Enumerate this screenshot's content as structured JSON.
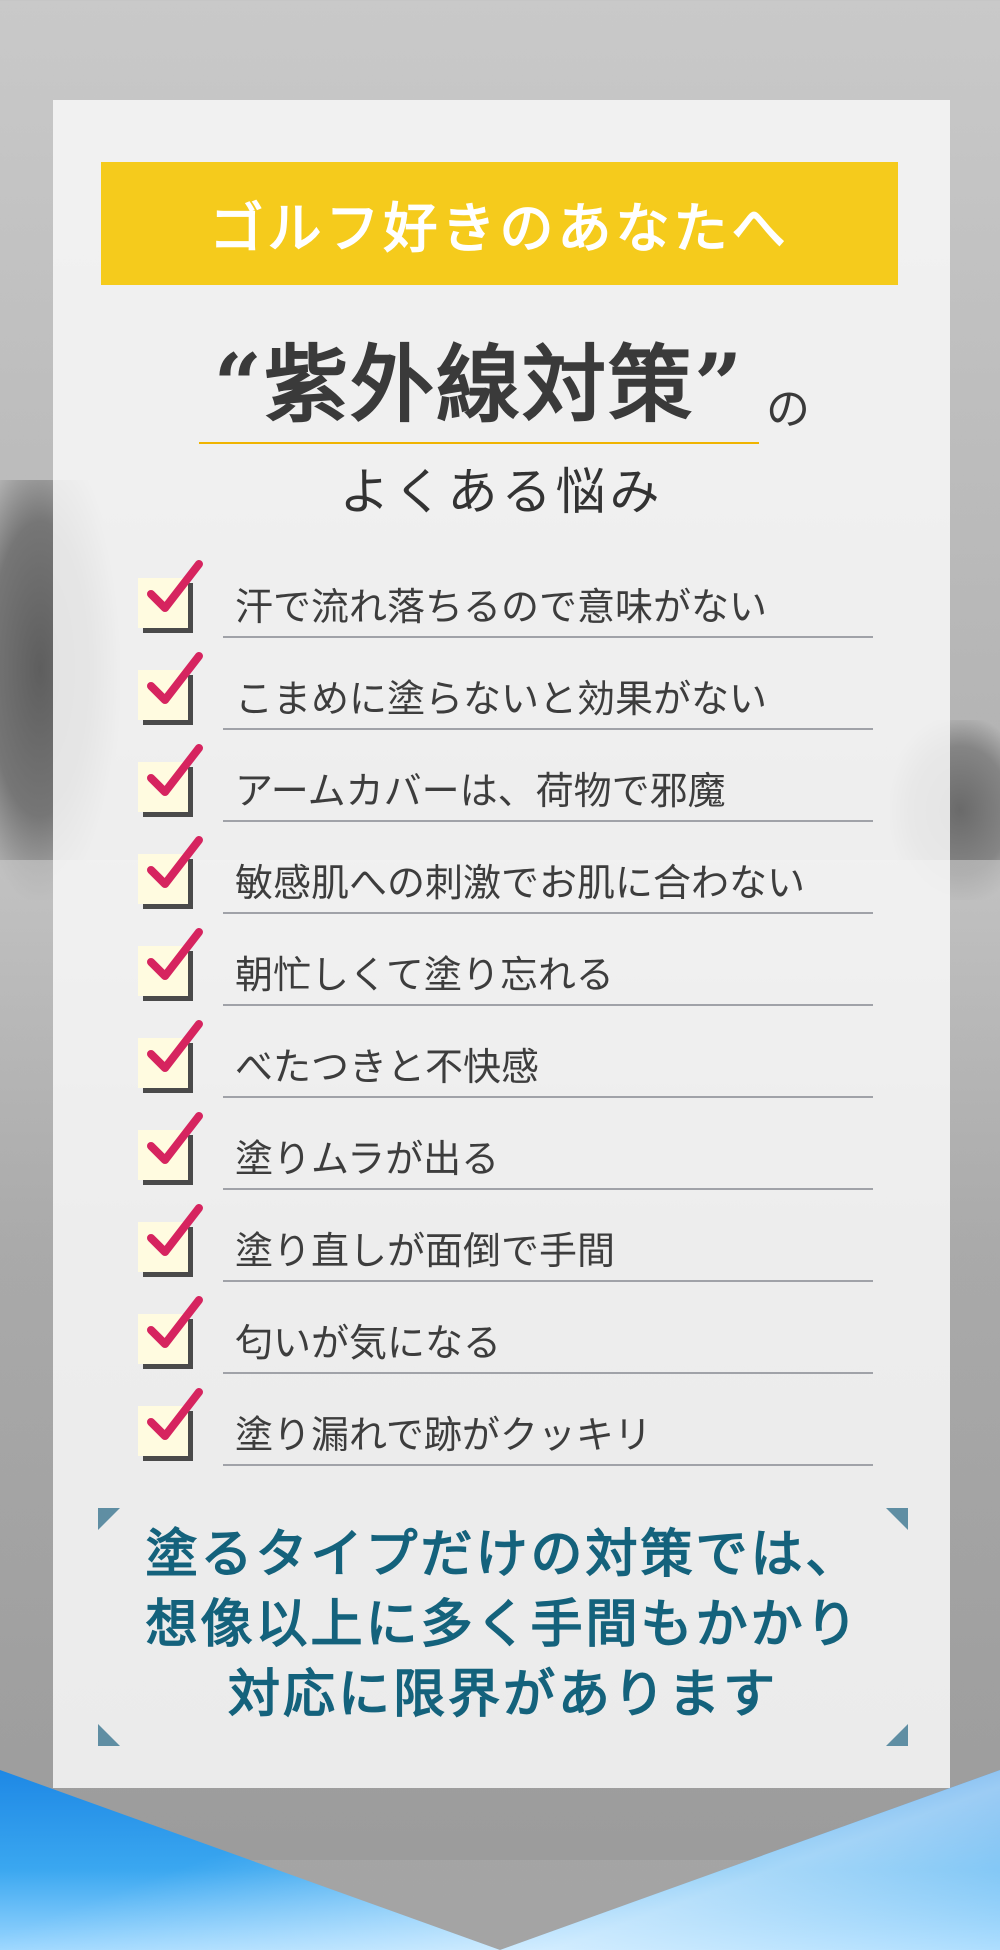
{
  "banner": {
    "text": "ゴルフ好きのあなたへ"
  },
  "headline": {
    "main": "“紫外線対策”",
    "suffix": "の"
  },
  "subhead": "よくある悩み",
  "checklist": [
    "汗で流れ落ちるので意味がない",
    "こまめに塗らないと効果がない",
    "アームカバーは、荷物で邪魔",
    "敏感肌への刺激でお肌に合わない",
    "朝忙しくて塗り忘れる",
    "べたつきと不快感",
    "塗りムラが出る",
    "塗り直しが面倒で手間",
    "匂いが気になる",
    "塗り漏れで跡がクッキリ"
  ],
  "closing": {
    "lines": [
      "塗るタイプだけの対策では、",
      "想像以上に多く手間もかかり",
      "対応に限界があります"
    ]
  },
  "colors": {
    "banner": "#f5cb1c",
    "check_mark": "#d6245f",
    "closing_text": "#14627c",
    "corner_marks": "#5f8ea3"
  },
  "icons": {
    "check": "checkbox-check-icon"
  }
}
